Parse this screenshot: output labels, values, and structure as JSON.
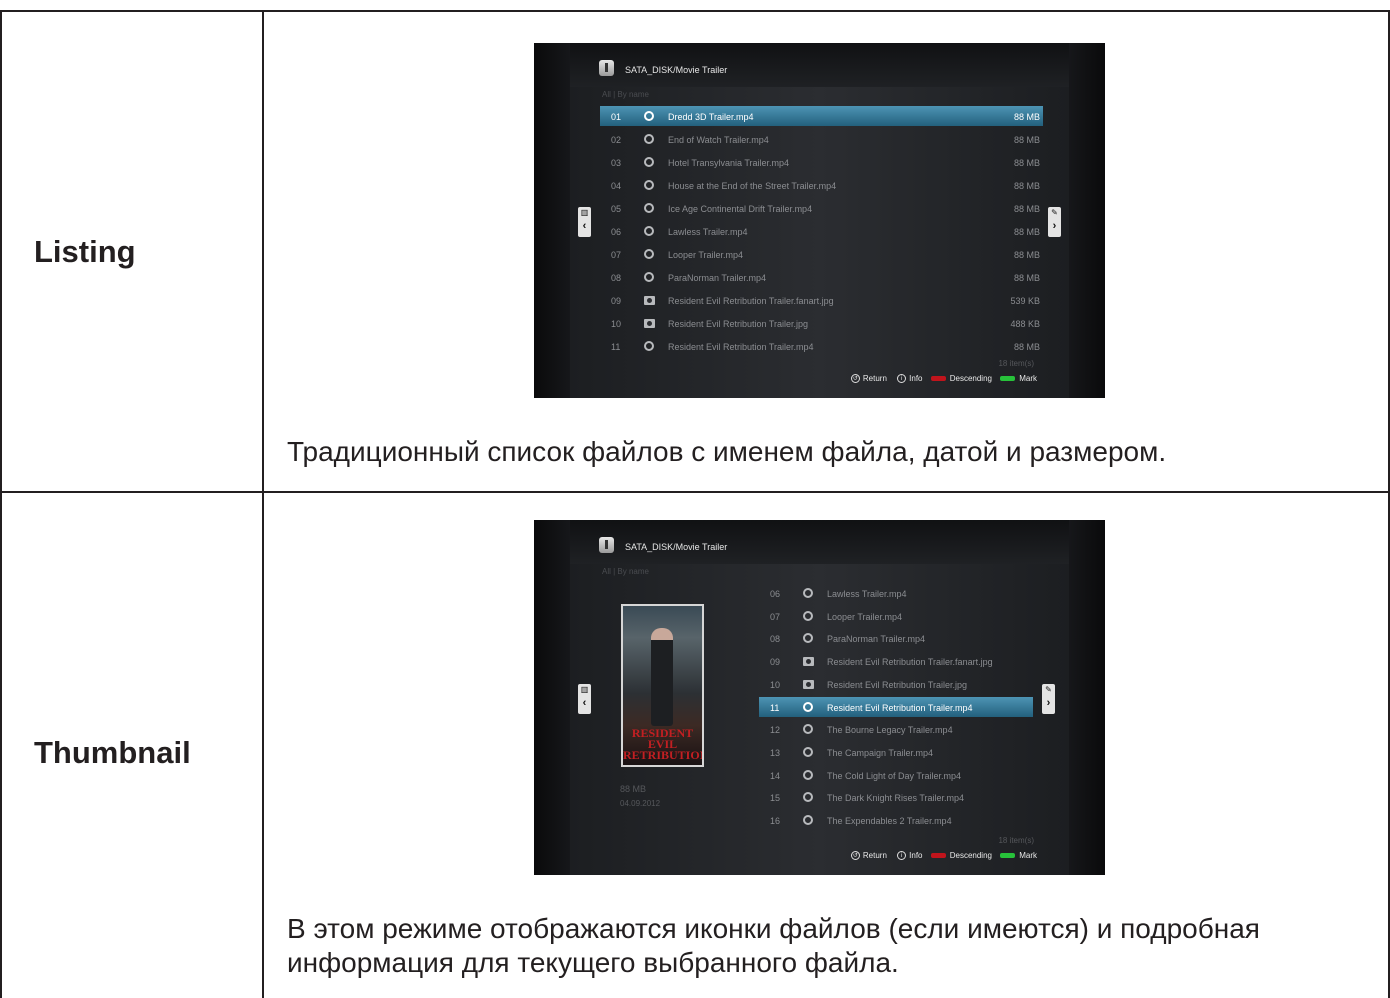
{
  "rows": [
    {
      "label": "Listing",
      "description": "Традиционный список файлов с именем файла, датой и размером.",
      "screen": {
        "path": "SATA_DISK/Movie Trailer",
        "sort": "All | By name",
        "items": [
          {
            "num": "01",
            "icon": "film-reel-icon",
            "name": "Dredd 3D Trailer.mp4",
            "size": "88 MB",
            "selected": true
          },
          {
            "num": "02",
            "icon": "film-reel-icon",
            "name": "End of Watch Trailer.mp4",
            "size": "88 MB"
          },
          {
            "num": "03",
            "icon": "film-reel-icon",
            "name": "Hotel Transylvania Trailer.mp4",
            "size": "88 MB"
          },
          {
            "num": "04",
            "icon": "film-reel-icon",
            "name": "House at the End of the Street Trailer.mp4",
            "size": "88 MB"
          },
          {
            "num": "05",
            "icon": "film-reel-icon",
            "name": "Ice Age Continental Drift Trailer.mp4",
            "size": "88 MB"
          },
          {
            "num": "06",
            "icon": "film-reel-icon",
            "name": "Lawless Trailer.mp4",
            "size": "88 MB"
          },
          {
            "num": "07",
            "icon": "film-reel-icon",
            "name": "Looper Trailer.mp4",
            "size": "88 MB"
          },
          {
            "num": "08",
            "icon": "film-reel-icon",
            "name": "ParaNorman Trailer.mp4",
            "size": "88 MB"
          },
          {
            "num": "09",
            "icon": "camera-icon",
            "name": "Resident Evil Retribution Trailer.fanart.jpg",
            "size": "539 KB"
          },
          {
            "num": "10",
            "icon": "camera-icon",
            "name": "Resident Evil Retribution Trailer.jpg",
            "size": "488 KB"
          },
          {
            "num": "11",
            "icon": "film-reel-icon",
            "name": "Resident Evil Retribution Trailer.mp4",
            "size": "88 MB"
          }
        ],
        "count": "18 item(s)",
        "footer": {
          "return": "Return",
          "info": "Info",
          "red": "Descending",
          "green": "Mark"
        }
      }
    },
    {
      "label": "Thumbnail",
      "description": "В этом режиме отображаются иконки файлов (если имеются) и подробная информация для текущего выбранного файла.",
      "screen": {
        "path": "SATA_DISK/Movie Trailer",
        "sort": "All | By name",
        "poster_title": "RESIDENT EVIL RETRIBUTION",
        "info_size": "88 MB",
        "info_date": "04.09.2012",
        "items": [
          {
            "num": "06",
            "icon": "film-reel-icon",
            "name": "Lawless Trailer.mp4"
          },
          {
            "num": "07",
            "icon": "film-reel-icon",
            "name": "Looper Trailer.mp4"
          },
          {
            "num": "08",
            "icon": "film-reel-icon",
            "name": "ParaNorman Trailer.mp4"
          },
          {
            "num": "09",
            "icon": "camera-icon",
            "name": "Resident Evil Retribution Trailer.fanart.jpg"
          },
          {
            "num": "10",
            "icon": "camera-icon",
            "name": "Resident Evil Retribution Trailer.jpg"
          },
          {
            "num": "11",
            "icon": "film-reel-icon",
            "name": "Resident Evil Retribution Trailer.mp4",
            "selected": true
          },
          {
            "num": "12",
            "icon": "film-reel-icon",
            "name": "The Bourne Legacy Trailer.mp4"
          },
          {
            "num": "13",
            "icon": "film-reel-icon",
            "name": "The Campaign Trailer.mp4"
          },
          {
            "num": "14",
            "icon": "film-reel-icon",
            "name": "The Cold Light of Day Trailer.mp4"
          },
          {
            "num": "15",
            "icon": "film-reel-icon",
            "name": "The Dark Knight Rises Trailer.mp4"
          },
          {
            "num": "16",
            "icon": "film-reel-icon",
            "name": "The Expendables 2 Trailer.mp4"
          }
        ],
        "count": "18 item(s)",
        "footer": {
          "return": "Return",
          "info": "Info",
          "red": "Descending",
          "green": "Mark"
        }
      }
    }
  ],
  "colors": {
    "red_key": "#c0141c",
    "green_key": "#27c23a",
    "selection": "#3a7c9c"
  }
}
